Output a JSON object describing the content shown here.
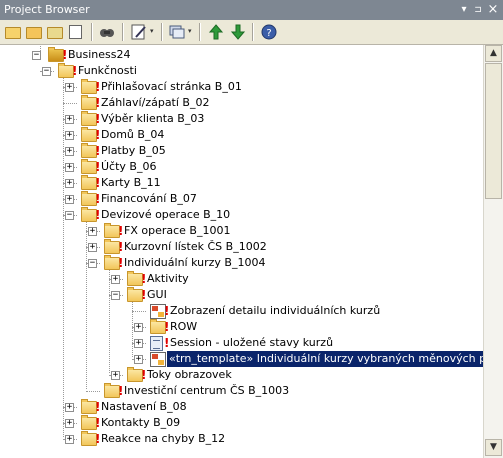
{
  "window": {
    "title": "Project Browser",
    "controls": {
      "pin": "▾",
      "close": "×"
    }
  },
  "toolbar": {
    "buttons": [
      {
        "name": "new-project-icon"
      },
      {
        "name": "open-folder-icon"
      },
      {
        "name": "tree-view-icon"
      },
      {
        "name": "properties-icon"
      },
      {
        "name": "find-icon"
      },
      {
        "name": "edit-icon"
      },
      {
        "name": "windows-icon"
      },
      {
        "name": "move-up-icon"
      },
      {
        "name": "move-down-icon"
      },
      {
        "name": "help-icon"
      }
    ],
    "dropdown_caret": "▾"
  },
  "tree": {
    "rows": [
      {
        "label": "Business24",
        "bang": true,
        "type": "model",
        "expander": "−"
      },
      {
        "label": "Funkčnosti",
        "bang": true,
        "type": "folder",
        "expander": "−"
      },
      {
        "label": "Přihlašovací stránka B_01",
        "bang": true,
        "type": "folder",
        "expander": "+"
      },
      {
        "label": "Záhlaví/zápatí B_02",
        "bang": true,
        "type": "folder",
        "expander": ""
      },
      {
        "label": "Výběr klienta B_03",
        "bang": true,
        "type": "folder",
        "expander": "+"
      },
      {
        "label": "Domů B_04",
        "bang": true,
        "type": "folder",
        "expander": "+"
      },
      {
        "label": "Platby B_05",
        "bang": true,
        "type": "folder",
        "expander": "+"
      },
      {
        "label": "Účty B_06",
        "bang": true,
        "type": "folder",
        "expander": "+"
      },
      {
        "label": "Karty B_11",
        "bang": true,
        "type": "folder",
        "expander": "+"
      },
      {
        "label": "Financování B_07",
        "bang": true,
        "type": "folder",
        "expander": "+"
      },
      {
        "label": "Devizové operace B_10",
        "bang": true,
        "type": "folder",
        "expander": "−"
      },
      {
        "label": "FX operace B_1001",
        "bang": true,
        "type": "folder",
        "expander": "+"
      },
      {
        "label": "Kurzovní lístek ČS  B_1002",
        "bang": true,
        "type": "folder",
        "expander": "+"
      },
      {
        "label": "Individuální kurzy B_1004",
        "bang": true,
        "type": "folder",
        "expander": "−"
      },
      {
        "label": "Aktivity",
        "bang": true,
        "type": "folder",
        "expander": "+"
      },
      {
        "label": "GUI",
        "bang": true,
        "type": "folder",
        "expander": "−"
      },
      {
        "label": "Zobrazení detailu individuálních kurzů",
        "bang": true,
        "type": "diagram",
        "expander": ""
      },
      {
        "label": "ROW",
        "bang": true,
        "type": "folder",
        "expander": "+"
      },
      {
        "label": "Session - uložené stavy kurzů",
        "bang": true,
        "type": "page",
        "expander": "+"
      },
      {
        "label": "«trn_template» Individuální kurzy vybraných měnových párů",
        "bang": false,
        "type": "gui",
        "expander": "+",
        "selected": true
      },
      {
        "label": "Toky obrazovek",
        "bang": true,
        "type": "folder",
        "expander": "+"
      },
      {
        "label": "Investiční centrum ČS B_1003",
        "bang": true,
        "type": "folder",
        "expander": ""
      },
      {
        "label": "Nastavení B_08",
        "bang": true,
        "type": "folder",
        "expander": "+"
      },
      {
        "label": "Kontakty B_09",
        "bang": true,
        "type": "folder",
        "expander": "+"
      },
      {
        "label": "Reakce na chyby B_12",
        "bang": true,
        "type": "folder",
        "expander": "+"
      }
    ]
  },
  "scrollbar": {
    "up": "▲",
    "down": "▼"
  }
}
